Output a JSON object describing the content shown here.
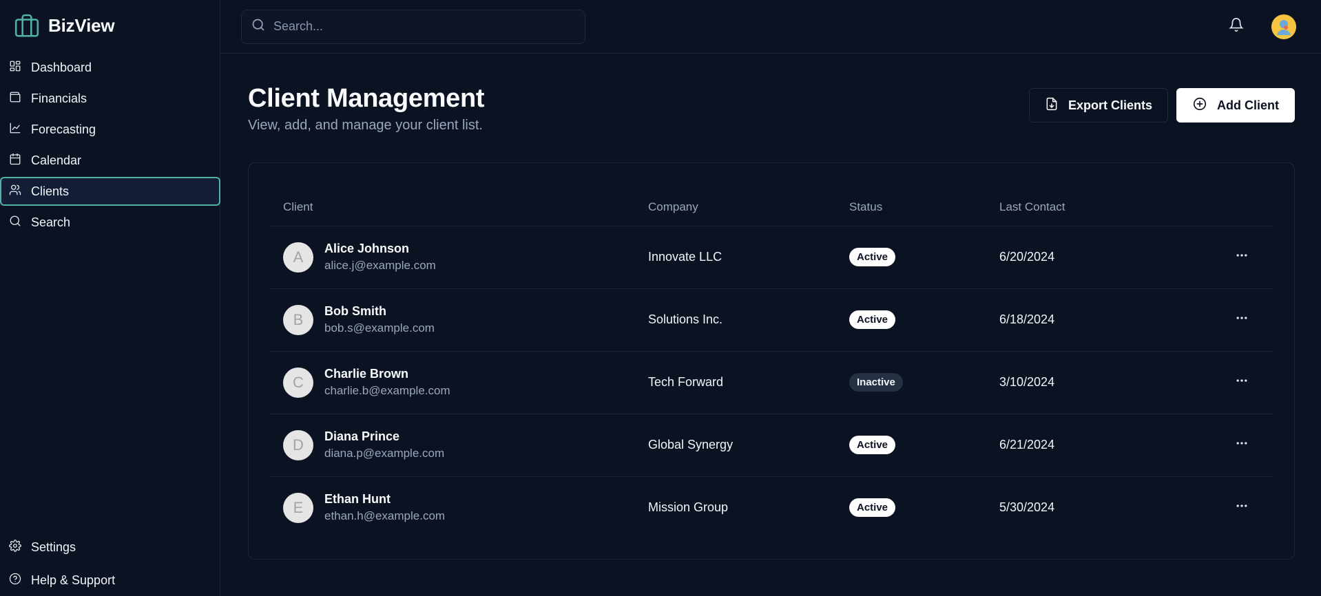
{
  "brand": {
    "name": "BizView",
    "accent": "#4fb3a5"
  },
  "sidebar": {
    "items": [
      {
        "label": "Dashboard",
        "icon": "dashboard-icon"
      },
      {
        "label": "Financials",
        "icon": "wallet-icon"
      },
      {
        "label": "Forecasting",
        "icon": "chart-line-icon"
      },
      {
        "label": "Calendar",
        "icon": "calendar-icon"
      },
      {
        "label": "Clients",
        "icon": "users-icon",
        "active": true
      },
      {
        "label": "Search",
        "icon": "search-icon"
      }
    ],
    "bottom": [
      {
        "label": "Settings",
        "icon": "gear-icon"
      },
      {
        "label": "Help & Support",
        "icon": "help-circle-icon"
      }
    ]
  },
  "topbar": {
    "search_placeholder": "Search..."
  },
  "page": {
    "title": "Client Management",
    "subtitle": "View, add, and manage your client list.",
    "export_label": "Export Clients",
    "add_label": "Add Client"
  },
  "table": {
    "headers": {
      "client": "Client",
      "company": "Company",
      "status": "Status",
      "last_contact": "Last Contact"
    },
    "rows": [
      {
        "initial": "A",
        "name": "Alice Johnson",
        "email": "alice.j@example.com",
        "company": "Innovate LLC",
        "status": "Active",
        "last_contact": "6/20/2024"
      },
      {
        "initial": "B",
        "name": "Bob Smith",
        "email": "bob.s@example.com",
        "company": "Solutions Inc.",
        "status": "Active",
        "last_contact": "6/18/2024"
      },
      {
        "initial": "C",
        "name": "Charlie Brown",
        "email": "charlie.b@example.com",
        "company": "Tech Forward",
        "status": "Inactive",
        "last_contact": "3/10/2024"
      },
      {
        "initial": "D",
        "name": "Diana Prince",
        "email": "diana.p@example.com",
        "company": "Global Synergy",
        "status": "Active",
        "last_contact": "6/21/2024"
      },
      {
        "initial": "E",
        "name": "Ethan Hunt",
        "email": "ethan.h@example.com",
        "company": "Mission Group",
        "status": "Active",
        "last_contact": "5/30/2024"
      }
    ]
  }
}
